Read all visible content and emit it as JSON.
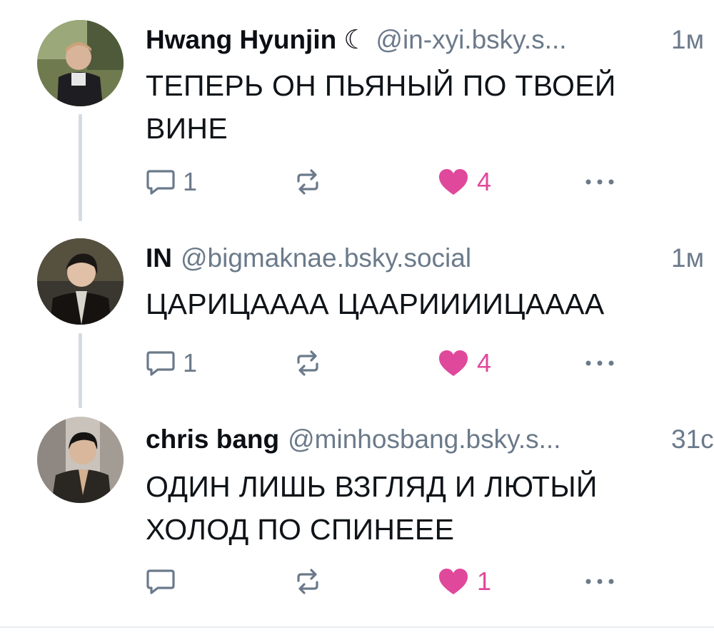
{
  "posts": [
    {
      "display_name": "Hwang Hyunjin",
      "display_suffix": "☾",
      "handle": "@in-xyi.bsky.s...",
      "time": "1м",
      "text": "ТЕПЕРЬ ОН ПЬЯНЫЙ ПО ТВОЕЙ ВИНЕ",
      "reply_count": "1",
      "like_count": "4",
      "liked": true
    },
    {
      "display_name": "IN",
      "display_suffix": "",
      "handle": "@bigmaknae.bsky.social",
      "time": "1м",
      "text": "ЦАРИЦАААА ЦААРИИИИЦАААА",
      "reply_count": "1",
      "like_count": "4",
      "liked": true
    },
    {
      "display_name": "chris bang",
      "display_suffix": "",
      "handle": "@minhosbang.bsky.s...",
      "time": "31с",
      "text": "ОДИН ЛИШЬ ВЗГЛЯД И ЛЮТЫЙ ХОЛОД ПО СПИНЕЕЕ",
      "reply_count": "",
      "like_count": "1",
      "liked": true
    }
  ],
  "icons": {
    "reply": "reply-bubble-icon",
    "repost": "repost-arrows-icon",
    "like": "heart-icon",
    "more": "more-dots-icon"
  },
  "colors": {
    "muted": "#6b7a8a",
    "like": "#e0489c",
    "thread_line": "#d4dbe2"
  }
}
